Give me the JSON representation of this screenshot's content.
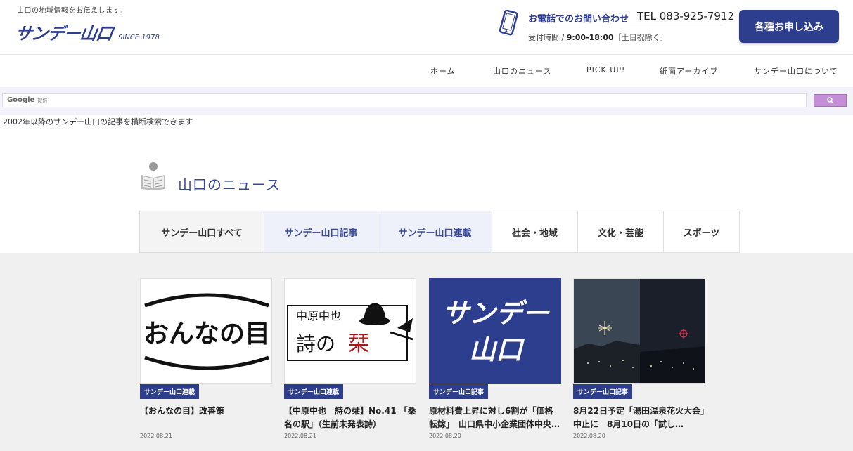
{
  "header": {
    "tagline": "山口の地域情報をお伝えします。",
    "logo": "サンデー山口",
    "since": "SINCE 1978",
    "contact_lead": "お電話でのお問い合わせ",
    "tel": "TEL 083-925-7912",
    "hours_label": "受付時間 / ",
    "hours_value": "9:00-18:00",
    "hours_note": "［土日祝除く］",
    "apply_button": "各種お申し込み"
  },
  "nav": {
    "items": [
      {
        "label": "ホーム"
      },
      {
        "label": "山口のニュース"
      },
      {
        "label": "PICK UP!"
      },
      {
        "label": "紙面アーカイブ"
      },
      {
        "label": "サンデー山口について"
      }
    ]
  },
  "search": {
    "brand": "Google",
    "brand_sub": "提供",
    "note": "2002年以降のサンデー山口の記事を横断検索できます"
  },
  "section": {
    "title": "山口のニュース"
  },
  "tabs": [
    {
      "label": "サンデー山口すべて"
    },
    {
      "label": "サンデー山口記事"
    },
    {
      "label": "サンデー山口連載"
    },
    {
      "label": "社会・地域"
    },
    {
      "label": "文化・芸能"
    },
    {
      "label": "スポーツ"
    }
  ],
  "articles": [
    {
      "category": "サンデー山口連載",
      "title": "【おんなの目】改善策",
      "date": "2022.08.21",
      "thumb_text": "おんなの目"
    },
    {
      "category": "サンデー山口連載",
      "title": "【中原中也　詩の栞】No.41 「桑名の駅」（生前未発表詩）",
      "date": "2022.08.21",
      "thumb_top": "中原中也",
      "thumb_main": "詩の",
      "thumb_red": "栞"
    },
    {
      "category": "サンデー山口記事",
      "title": "原材料費上昇に対し6割が「価格転嫁」　山口県中小企業団体中央…",
      "date": "2022.08.20",
      "thumb_line1": "サンデー",
      "thumb_line2": "山口"
    },
    {
      "category": "サンデー山口記事",
      "title": "8月22日予定「湯田温泉花火大会」中止に　8月10日の「試し…",
      "date": "2022.08.20"
    }
  ],
  "colors": {
    "brand": "#2d3e8f",
    "search_button": "#c58fd8",
    "grid_background": "#f0f0f0"
  }
}
